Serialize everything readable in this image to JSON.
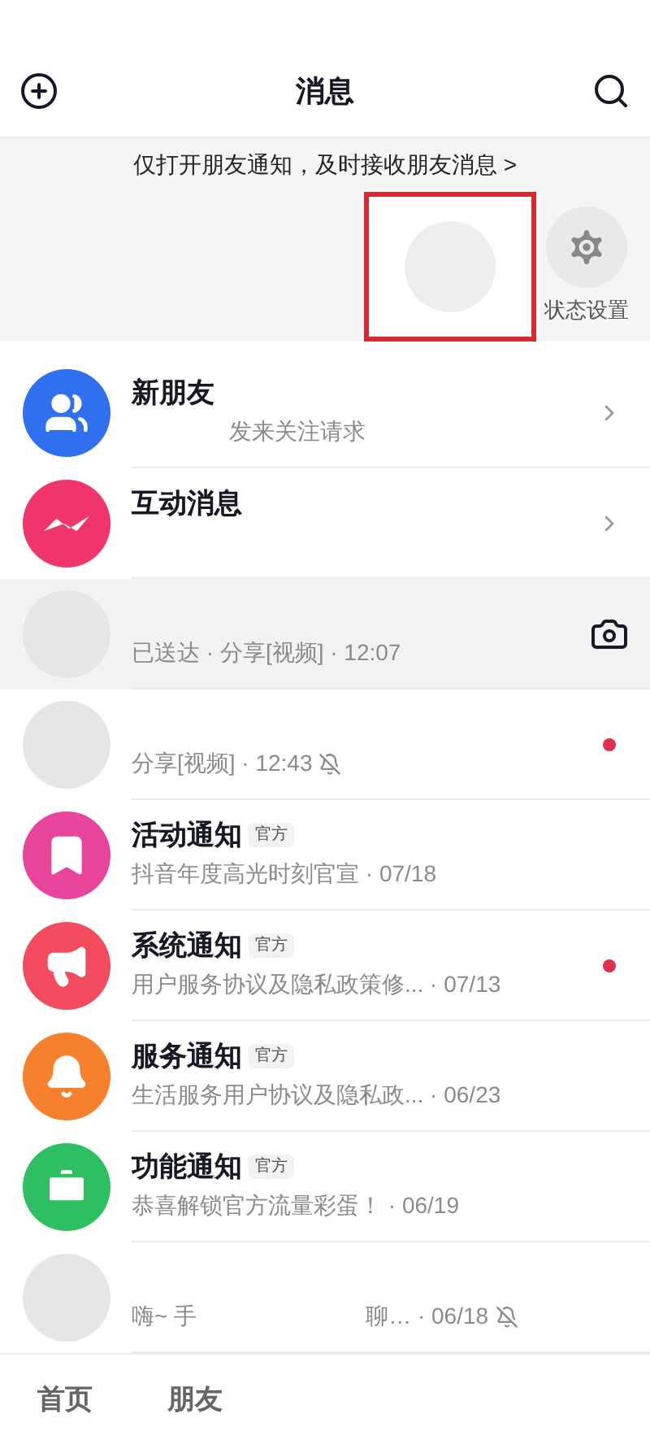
{
  "header": {
    "title": "消息"
  },
  "banner": {
    "text": "仅打开朋友通知，及时接收朋友消息",
    "chevron": ">"
  },
  "status_strip": {
    "settings_label": "状态设置",
    "highlighted": true
  },
  "rows": [
    {
      "kind": "system",
      "color": "#2f6ff0",
      "title": "新朋友",
      "subtitle": "发来关注请求",
      "chevron": true
    },
    {
      "kind": "system",
      "color": "#f0356b",
      "title": "互动消息",
      "chevron": true
    },
    {
      "kind": "chat",
      "pinned": true,
      "subtitle": "已送达 · 分享[视频] · 12:07",
      "camera": true
    },
    {
      "kind": "chat",
      "pinned": false,
      "subtitle": "分享[视频] · 12:43",
      "muted": true,
      "unread": true
    },
    {
      "kind": "official",
      "color": "#e8459a",
      "title": "活动通知",
      "badge": "官方",
      "subtitle": "抖音年度高光时刻官宣 · 07/18",
      "unread": false
    },
    {
      "kind": "official",
      "color": "#f24b5e",
      "title": "系统通知",
      "badge": "官方",
      "subtitle": "用户服务协议及隐私政策修... · 07/13",
      "unread": true
    },
    {
      "kind": "official",
      "color": "#f7802f",
      "title": "服务通知",
      "badge": "官方",
      "subtitle": "生活服务用户协议及隐私政... · 06/23",
      "unread": false
    },
    {
      "kind": "official",
      "color": "#2fbf63",
      "title": "功能通知",
      "badge": "官方",
      "subtitle": "恭喜解锁官方流量彩蛋！ · 06/19",
      "unread": false
    },
    {
      "kind": "chat",
      "pinned": false,
      "subtitle": "嗨~ 手",
      "subtitle_end": "聊… · 06/18",
      "muted": true,
      "unread": false
    }
  ],
  "tabbar": [
    {
      "label": "首页",
      "selected": false
    },
    {
      "label": "朋友",
      "selected": false
    }
  ]
}
